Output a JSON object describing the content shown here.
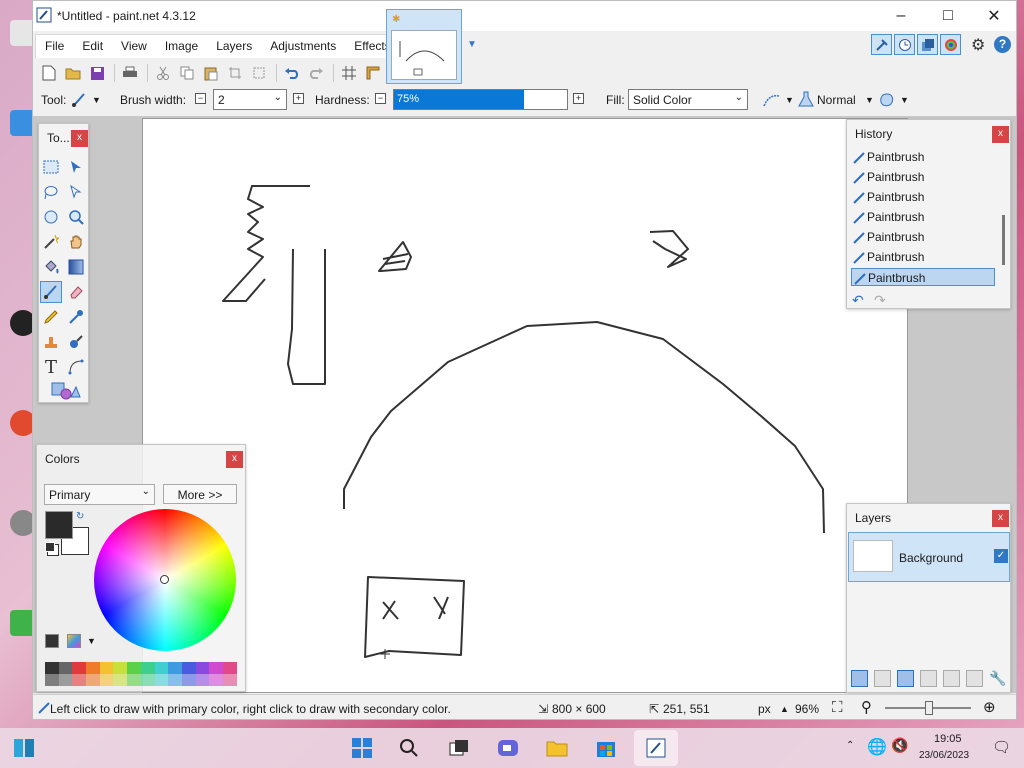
{
  "window": {
    "title": "*Untitled - paint.net 4.3.12"
  },
  "menu": [
    "File",
    "Edit",
    "View",
    "Image",
    "Layers",
    "Adjustments",
    "Effects"
  ],
  "options": {
    "tool_label": "Tool:",
    "brush_width_label": "Brush width:",
    "brush_width_value": "2",
    "hardness_label": "Hardness:",
    "hardness_value": "75%",
    "hardness_fraction": 0.75,
    "fill_label": "Fill:",
    "fill_value": "Solid Color",
    "blend_mode": "Normal"
  },
  "tools_panel": {
    "title": "To..."
  },
  "colors_panel": {
    "title": "Colors",
    "mode": "Primary",
    "more_button": "More >>",
    "primary_color": "#2a2a2a",
    "secondary_color": "#ffffff",
    "palette": [
      "#333333",
      "#666666",
      "#e03b3b",
      "#f07b2a",
      "#f3c22e",
      "#c8e03a",
      "#5bd04a",
      "#3fcf8c",
      "#3fcfd0",
      "#3f9be0",
      "#4a5be0",
      "#8a4ae0",
      "#d04ad0",
      "#e04a8a"
    ]
  },
  "history_panel": {
    "title": "History",
    "items": [
      "Paintbrush",
      "Paintbrush",
      "Paintbrush",
      "Paintbrush",
      "Paintbrush",
      "Paintbrush",
      "Paintbrush"
    ]
  },
  "layers_panel": {
    "title": "Layers",
    "layer_name": "Background"
  },
  "status": {
    "hint": "Left click to draw with primary color, right click to draw with secondary color.",
    "size": "800 × 600",
    "cursor": "251, 551",
    "unit": "px",
    "zoom": "96%"
  },
  "taskbar": {
    "time": "19:05",
    "date": "23/06/2023"
  },
  "accent": "#0a78d7"
}
